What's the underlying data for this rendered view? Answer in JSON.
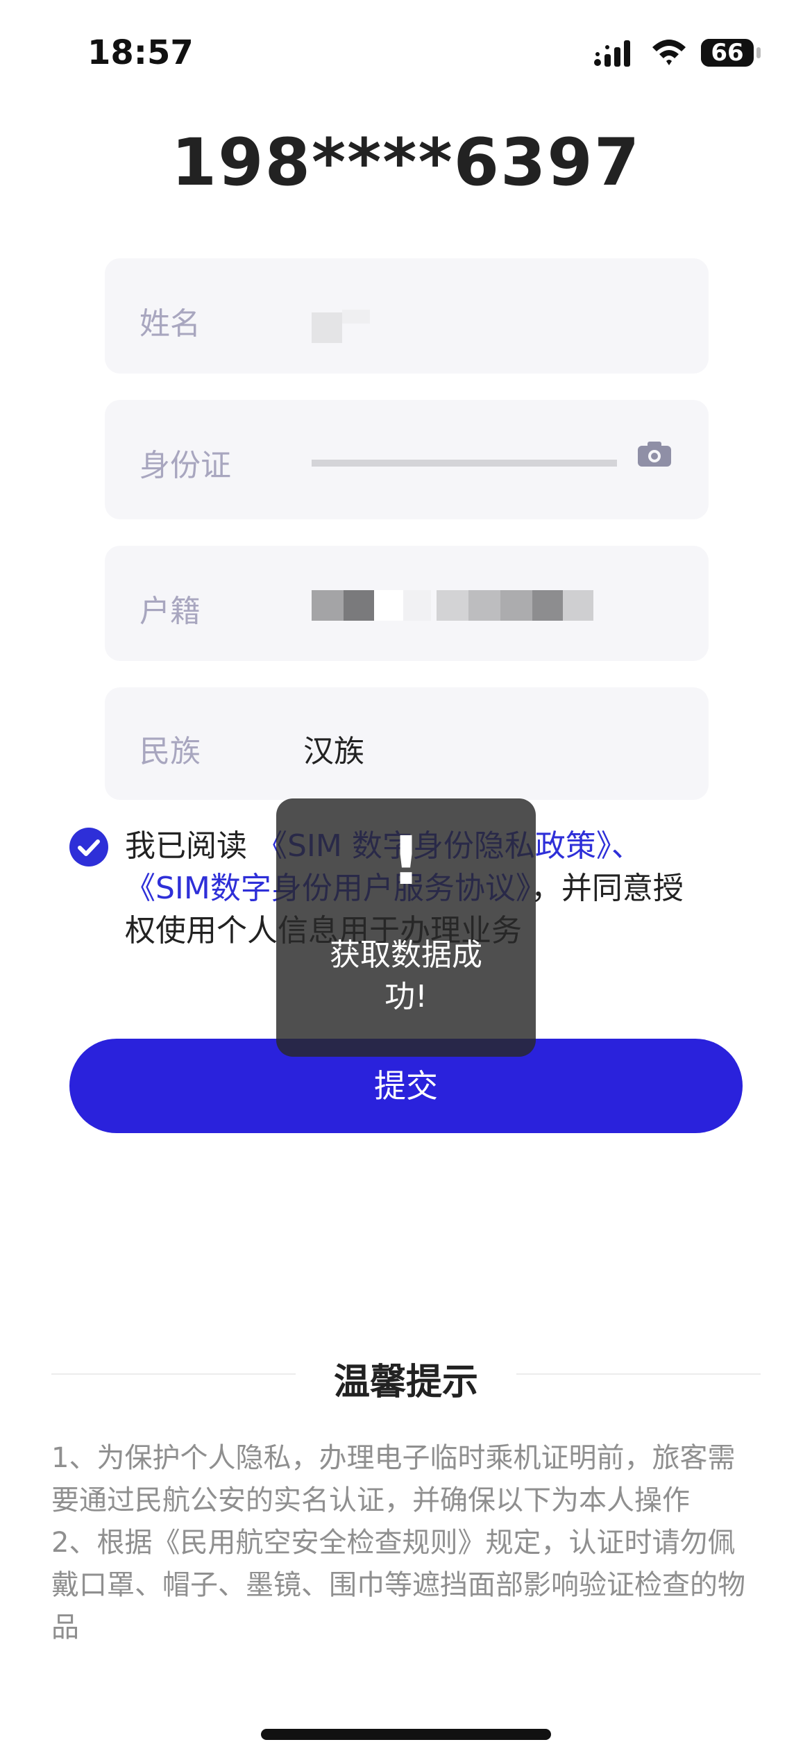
{
  "status_bar": {
    "time": "18:57",
    "battery": "66",
    "battery_level": 0.66
  },
  "phone_number": "198****6397",
  "fields": [
    {
      "label": "姓名",
      "value": ""
    },
    {
      "label": "身份证",
      "value": ""
    },
    {
      "label": "户籍",
      "value": ""
    },
    {
      "label": "民族",
      "value": "汉族"
    }
  ],
  "agreement": {
    "prefix": "我已阅读",
    "link1": "《SIM 数字身份隐私政策》、",
    "link2": "《SIM数字身份用户服务协议》",
    "suffix": "，并同意授权使用个人信息用于办理业务"
  },
  "submit_label": "提交",
  "toast": {
    "icon": "exclamation-icon",
    "message": "获取数据成功!"
  },
  "tips": {
    "title": "温馨提示",
    "items": [
      "1、为保护个人隐私，办理电子临时乘机证明前，旅客需要通过民航公安的实名认证，并确保以下为本人操作",
      "2、根据《民用航空安全检查规则》规定，认证时请勿佩戴口罩、帽子、墨镜、围巾等遮挡面部影响验证检查的物品"
    ]
  },
  "colors": {
    "accent": "#2a22dc",
    "field_bg": "#f6f6f9",
    "label": "#a8a6bf",
    "tips_text": "#8f8f8f"
  }
}
